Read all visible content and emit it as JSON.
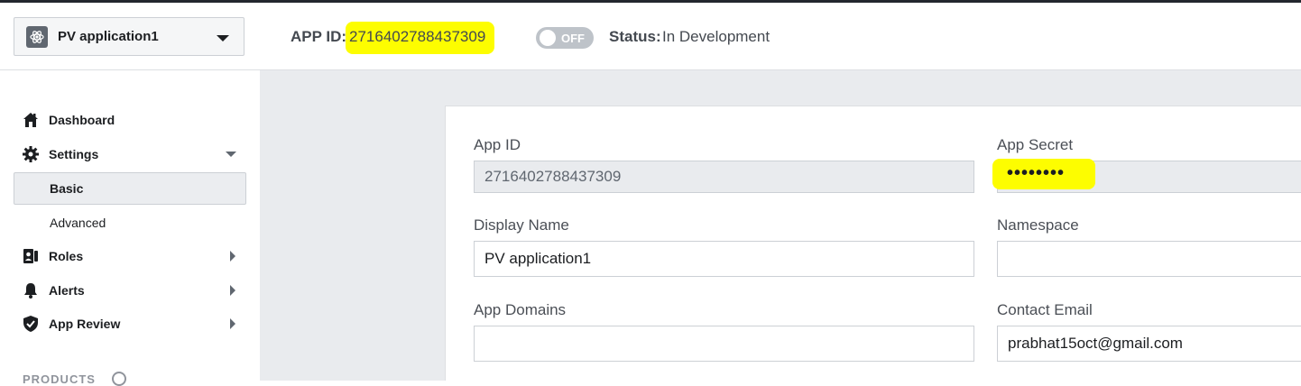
{
  "header": {
    "app_name": "PV application1",
    "app_id_label": "APP ID:",
    "app_id_value": "2716402788437309",
    "toggle_text": "OFF",
    "status_label": "Status:",
    "status_value": "In Development",
    "highlight_color": "#fdfd00"
  },
  "sidebar": {
    "items": [
      {
        "label": "Dashboard",
        "icon": "home-icon"
      },
      {
        "label": "Settings",
        "icon": "gear-icon"
      },
      {
        "label": "Basic"
      },
      {
        "label": "Advanced"
      },
      {
        "label": "Roles",
        "icon": "roles-icon"
      },
      {
        "label": "Alerts",
        "icon": "bell-icon"
      },
      {
        "label": "App Review",
        "icon": "shield-icon"
      }
    ],
    "products_label": "PRODUCTS"
  },
  "form": {
    "app_id_label": "App ID",
    "app_id_value": "2716402788437309",
    "app_secret_label": "App Secret",
    "app_secret_value": "••••••••",
    "display_name_label": "Display Name",
    "display_name_value": "PV application1",
    "namespace_label": "Namespace",
    "namespace_value": "",
    "app_domains_label": "App Domains",
    "app_domains_value": "",
    "contact_email_label": "Contact Email",
    "contact_email_value": "prabhat15oct@gmail.com"
  }
}
